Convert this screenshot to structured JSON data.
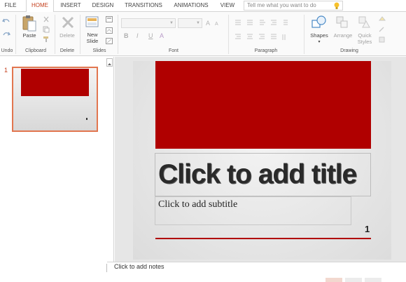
{
  "tabs": [
    {
      "label": "FILE",
      "active": false
    },
    {
      "label": "HOME",
      "active": true
    },
    {
      "label": "INSERT",
      "active": false
    },
    {
      "label": "DESIGN",
      "active": false
    },
    {
      "label": "TRANSITIONS",
      "active": false
    },
    {
      "label": "ANIMATIONS",
      "active": false
    },
    {
      "label": "VIEW",
      "active": false
    }
  ],
  "tellme": {
    "placeholder": "Tell me what you want to do"
  },
  "ribbon": {
    "groups": {
      "undo": "Undo",
      "clipboard": "Clipboard",
      "delete": "Delete",
      "slides": "Slides",
      "font": "Font",
      "paragraph": "Paragraph",
      "drawing": "Drawing"
    },
    "buttons": {
      "paste": "Paste",
      "delete": "Delete",
      "new_slide_1": "New",
      "new_slide_2": "Slide",
      "shapes": "Shapes",
      "arrange": "Arrange",
      "quick_styles_1": "Quick",
      "quick_styles_2": "Styles"
    },
    "format": {
      "bold": "B",
      "italic": "I",
      "underline": "U",
      "font_color": "A"
    }
  },
  "thumbnails": [
    {
      "number": "1"
    }
  ],
  "slide": {
    "title_placeholder": "Click to add title",
    "subtitle_placeholder": "Click to add subtitle",
    "page_number": "1"
  },
  "notes": {
    "placeholder": "Click to add notes"
  },
  "colors": {
    "accent": "#c43e1c",
    "slide_red": "#b00000",
    "selection": "#e2764f"
  }
}
